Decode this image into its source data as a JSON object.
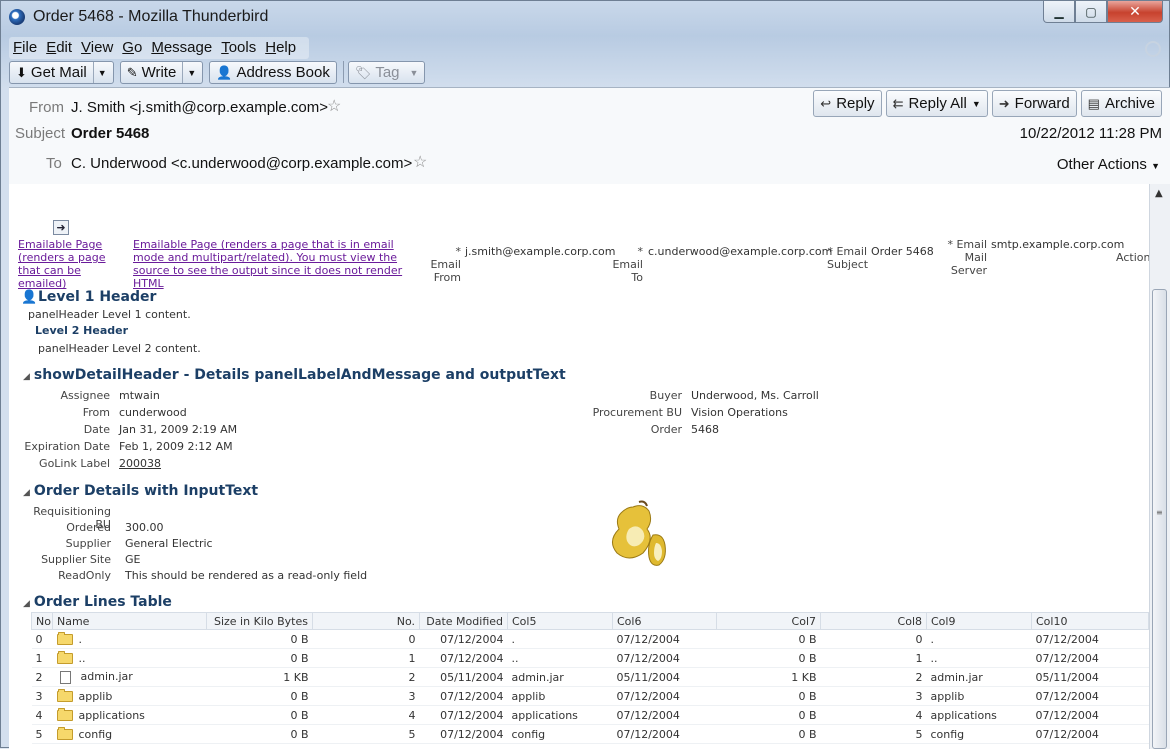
{
  "window": {
    "title": "Order 5468 - Mozilla Thunderbird",
    "minimize": "▁",
    "maximize": "▢",
    "close": "✕"
  },
  "menu": [
    "File",
    "Edit",
    "View",
    "Go",
    "Message",
    "Tools",
    "Help"
  ],
  "toolbar": {
    "get_mail": "Get Mail",
    "write": "Write",
    "address_book": "Address Book",
    "tag": "Tag"
  },
  "header": {
    "from_label": "From",
    "from_value": "J. Smith <j.smith@corp.example.com>",
    "subject_label": "Subject",
    "subject_value": "Order 5468",
    "to_label": "To",
    "to_value": "C. Underwood <c.underwood@corp.example.com>",
    "datetime": "10/22/2012 11:28 PM",
    "other_actions": "Other Actions",
    "reply": "Reply",
    "reply_all": "Reply All",
    "forward": "Forward",
    "archive": "Archive"
  },
  "body": {
    "emailable_link1": "Emailable Page (renders a page that can be emailed)",
    "emailable_link2": "Emailable Page (renders a page that is in email mode and multipart/related). You must view the source to see the output since it does not render HTML",
    "email_from_label": "* Email From",
    "email_from_value": "j.smith@example.corp.com",
    "email_to_label": "* Email To",
    "email_to_value": "c.underwood@example.corp.com",
    "email_subject_label": "* Email Subject",
    "email_subject_value": "Order 5468",
    "email_server_label": "* Email Mail Server",
    "email_server_value": "smtp.example.corp.com",
    "action_label": "Action",
    "level1_header": "Level 1 Header",
    "level1_content": "panelHeader Level 1 content.",
    "level2_header": "Level 2 Header",
    "level2_content": "panelHeader Level 2 content.",
    "details_title": "showDetailHeader - Details panelLabelAndMessage and outputText",
    "details_left": [
      {
        "label": "Assignee",
        "value": "mtwain"
      },
      {
        "label": "From",
        "value": "cunderwood"
      },
      {
        "label": "Date",
        "value": "Jan 31, 2009 2:19 AM"
      },
      {
        "label": "Expiration Date",
        "value": "Feb 1, 2009 2:12 AM"
      },
      {
        "label": "GoLink Label",
        "value": "200038"
      }
    ],
    "details_right": [
      {
        "label": "Buyer",
        "value": "Underwood, Ms. Carroll"
      },
      {
        "label": "Procurement BU",
        "value": "Vision Operations"
      },
      {
        "label": "Order",
        "value": "5468"
      }
    ],
    "order_details_title": "Order Details with InputText",
    "order_details": [
      {
        "label": "Requisitioning BU",
        "value": ""
      },
      {
        "label": "Ordered",
        "value": "300.00"
      },
      {
        "label": "Supplier",
        "value": "General Electric"
      },
      {
        "label": "Supplier Site",
        "value": "GE"
      },
      {
        "label": "ReadOnly",
        "value": "This should be rendered as a read-only field"
      }
    ],
    "order_lines_title": "Order Lines Table",
    "columns": [
      "No",
      "Name",
      "Size in Kilo Bytes",
      "No.",
      "Date Modified",
      "Col5",
      "Col6",
      "Col7",
      "Col8",
      "Col9",
      "Col10"
    ],
    "rows": [
      {
        "no": "0",
        "icon": "folder",
        "name": ".",
        "size": "0 B",
        "no2": "0",
        "date": "07/12/2004",
        "col5": ".",
        "col6": "07/12/2004",
        "col7": "0 B",
        "col8": "0",
        "col9": ".",
        "col10": "07/12/2004"
      },
      {
        "no": "1",
        "icon": "folder",
        "name": "..",
        "size": "0 B",
        "no2": "1",
        "date": "07/12/2004",
        "col5": "..",
        "col6": "07/12/2004",
        "col7": "0 B",
        "col8": "1",
        "col9": "..",
        "col10": "07/12/2004"
      },
      {
        "no": "2",
        "icon": "file",
        "name": "admin.jar",
        "size": "1 KB",
        "no2": "2",
        "date": "05/11/2004",
        "col5": "admin.jar",
        "col6": "05/11/2004",
        "col7": "1 KB",
        "col8": "2",
        "col9": "admin.jar",
        "col10": "05/11/2004"
      },
      {
        "no": "3",
        "icon": "folder",
        "name": "applib",
        "size": "0 B",
        "no2": "3",
        "date": "07/12/2004",
        "col5": "applib",
        "col6": "07/12/2004",
        "col7": "0 B",
        "col8": "3",
        "col9": "applib",
        "col10": "07/12/2004"
      },
      {
        "no": "4",
        "icon": "folder",
        "name": "applications",
        "size": "0 B",
        "no2": "4",
        "date": "07/12/2004",
        "col5": "applications",
        "col6": "07/12/2004",
        "col7": "0 B",
        "col8": "4",
        "col9": "applications",
        "col10": "07/12/2004"
      },
      {
        "no": "5",
        "icon": "folder",
        "name": "config",
        "size": "0 B",
        "no2": "5",
        "date": "07/12/2004",
        "col5": "config",
        "col6": "07/12/2004",
        "col7": "0 B",
        "col8": "5",
        "col9": "config",
        "col10": "07/12/2004"
      }
    ]
  }
}
